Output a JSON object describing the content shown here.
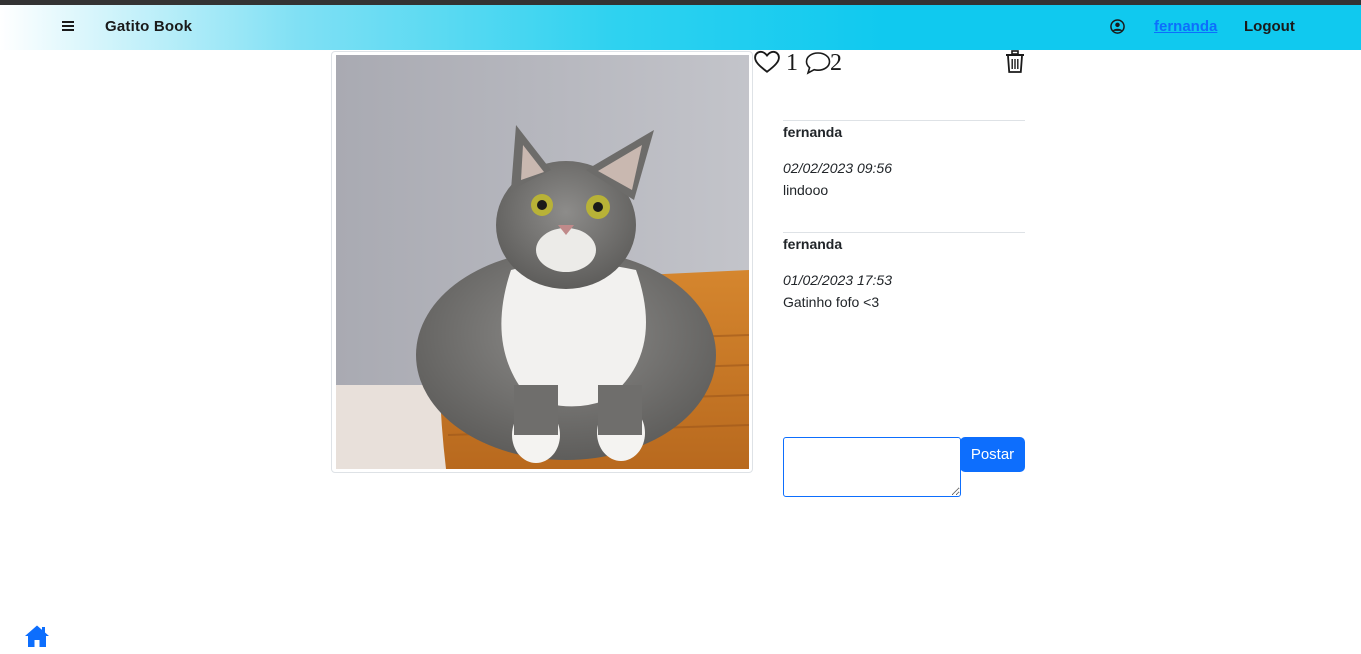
{
  "navbar": {
    "brand": "Gatito Book",
    "username": "fernanda",
    "logout_label": "Logout",
    "menu_icon": "hamburger-menu-icon",
    "user_icon": "user-circle-icon"
  },
  "photo": {
    "alt": "gray and white cat in a wicker basket",
    "likes": "1",
    "comments_count": "2"
  },
  "comments": [
    {
      "author": "fernanda",
      "date": "02/02/2023 09:56",
      "text": "lindooo"
    },
    {
      "author": "fernanda",
      "date": "01/02/2023 17:53",
      "text": "Gatinho fofo <3"
    }
  ],
  "comment_form": {
    "value": "",
    "post_label": "Postar"
  },
  "colors": {
    "primary": "#0d6efd",
    "navbar_accent": "#10c9ef"
  }
}
